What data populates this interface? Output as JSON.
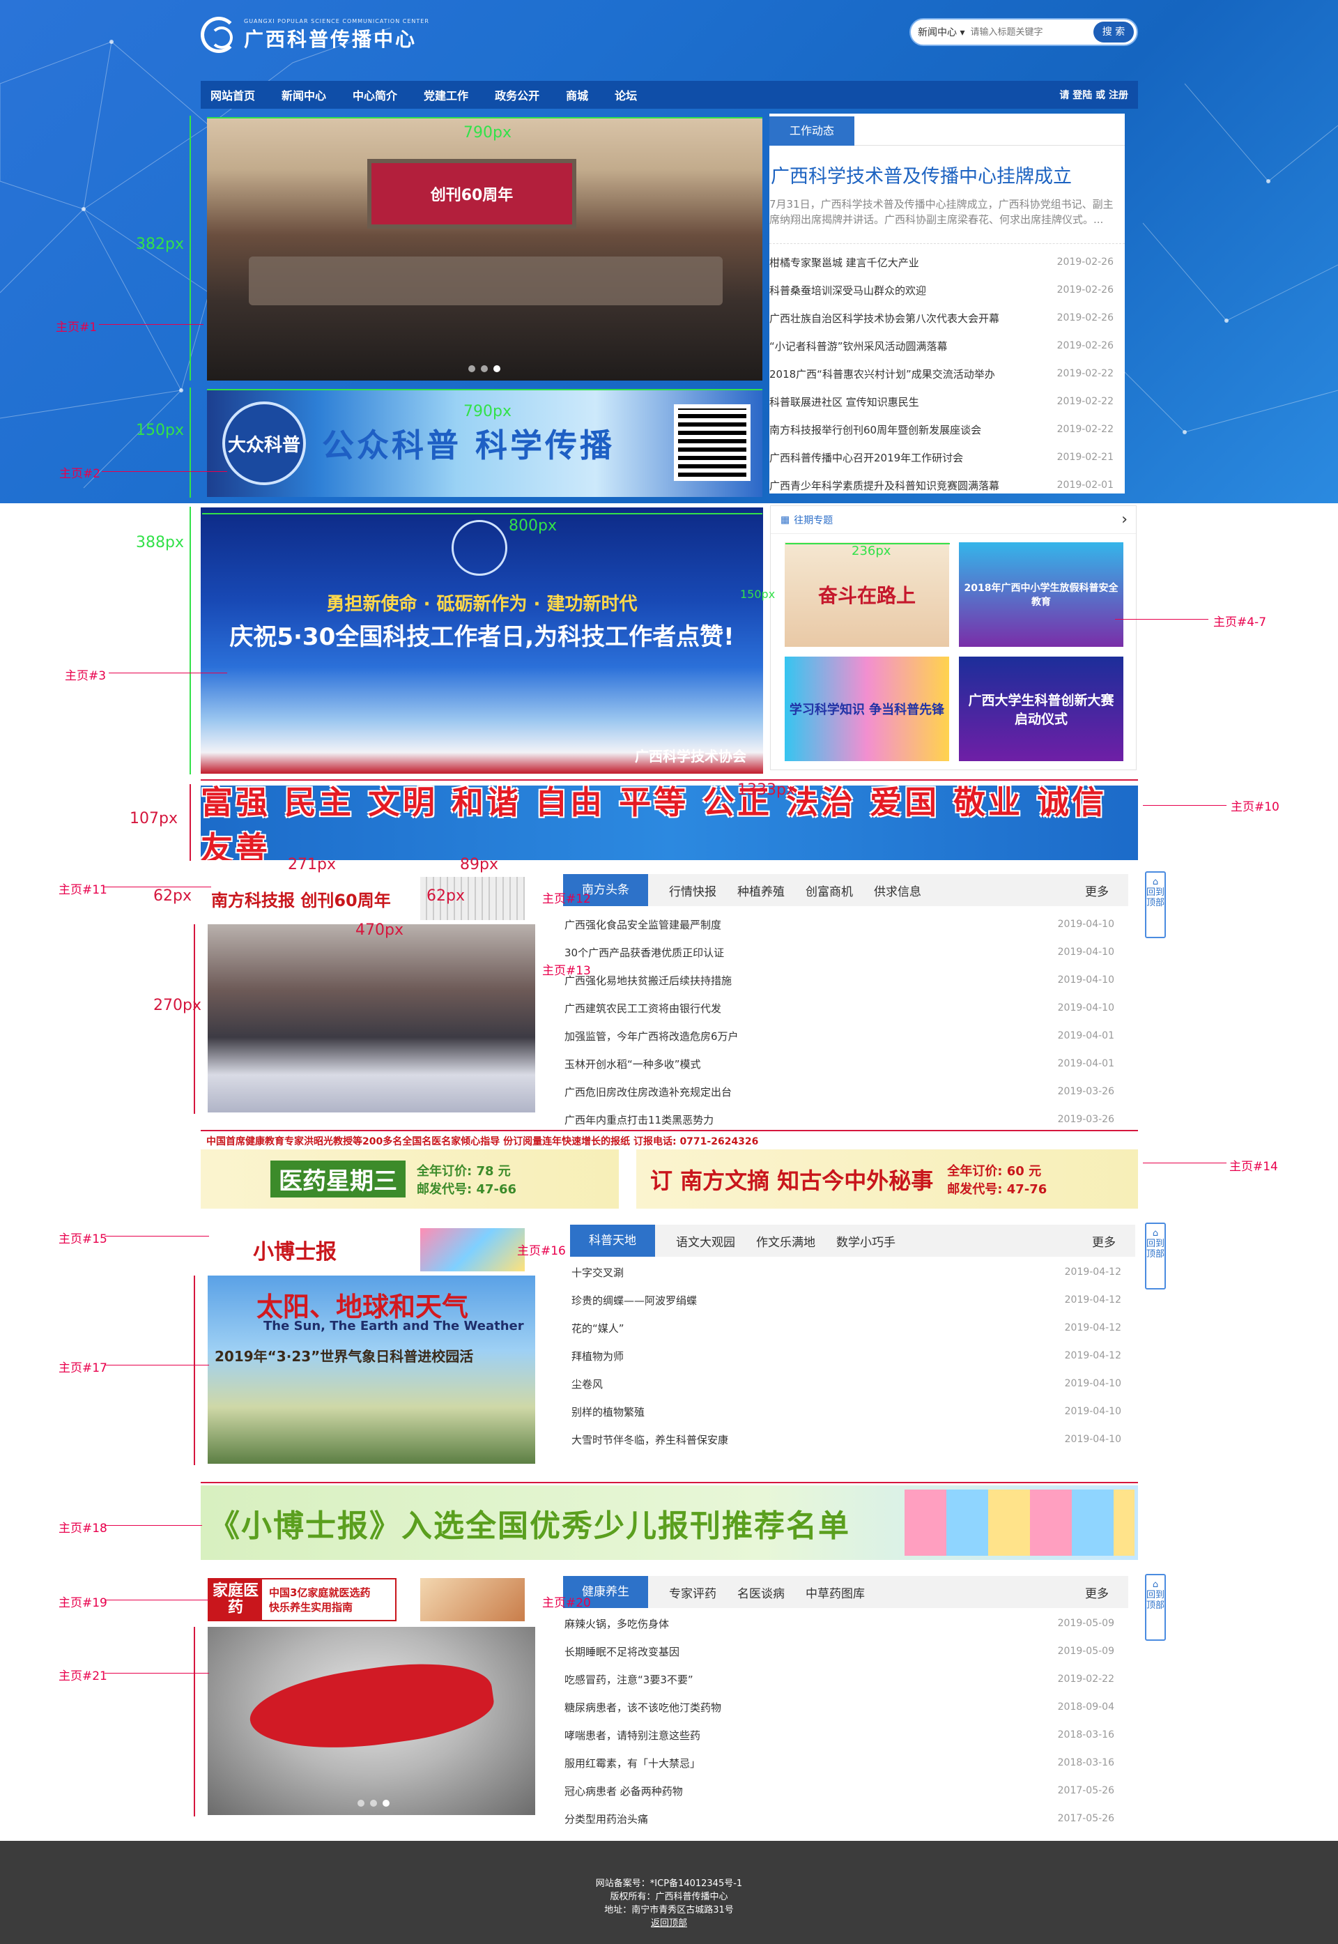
{
  "header": {
    "logo_en": "GUANGXI POPULAR SCIENCE COMMUNICATION CENTER",
    "logo_cn": "广西科普传播中心",
    "search_select": "新闻中心",
    "search_placeholder": "请输入标题关键字",
    "search_button": "搜 索"
  },
  "nav": {
    "items": [
      "网站首页",
      "新闻中心",
      "中心简介",
      "党建工作",
      "政务公开",
      "商城",
      "论坛"
    ],
    "login": "请 登陆 或 注册"
  },
  "work_news": {
    "tab": "工作动态",
    "lead_title": "广西科学技术普及传播中心挂牌成立",
    "lead_text": "7月31日，广西科学技术普及传播中心挂牌成立，广西科协党组书记、副主席纳翔出席揭牌并讲话。广西科协副主席梁春花、何求出席挂牌仪式。...",
    "items": [
      {
        "title": "柑橘专家聚邕城 建言千亿大产业",
        "date": "2019-02-26"
      },
      {
        "title": "科普桑蚕培训深受马山群众的欢迎",
        "date": "2019-02-26"
      },
      {
        "title": "广西壮族自治区科学技术协会第八次代表大会开幕",
        "date": "2019-02-26"
      },
      {
        "title": "“小记者科普游”钦州采风活动圆满落幕",
        "date": "2019-02-26"
      },
      {
        "title": "2018广西“科普惠农兴村计划”成果交流活动举办",
        "date": "2019-02-22"
      },
      {
        "title": "科普联展进社区 宣传知识惠民生",
        "date": "2019-02-22"
      },
      {
        "title": "南方科技报举行创刊60周年暨创新发展座谈会",
        "date": "2019-02-22"
      },
      {
        "title": "广西科普传播中心召开2019年工作研讨会",
        "date": "2019-02-21"
      },
      {
        "title": "广西青少年科学素质提升及科普知识竞赛圆满落幕",
        "date": "2019-02-01"
      }
    ]
  },
  "slides": {
    "banner2_text": "公众科普 科学传播",
    "banner2_logo": "大众科普",
    "banner3_line1": "勇担新使命 · 砥砺新作为 · 建功新时代",
    "banner3_line2": "庆祝5·30全国科技工作者日,为科技工作者点赞!",
    "banner3_org": "广西科学技术协会",
    "photo1_caption": "创刊60周年"
  },
  "topics": {
    "header": "往期专题",
    "tiles": [
      "奋斗在路上",
      "2018年广西中小学生放假科普安全教育",
      "学习科学知识 争当科普先锋",
      "广西大学生科普创新大赛启动仪式"
    ]
  },
  "banners": {
    "values": "富强 民主 文明 和谐 自由 平等 公正 法治 爱国 敬业 诚信 友善",
    "health_paper": "医药星期三",
    "health_price": "全年订价: 78 元",
    "health_code": "邮发代号: 47-66",
    "south_digest": "订 南方文摘 知古今中外秘事",
    "south_price": "全年订价: 60 元",
    "south_code": "邮发代号: 47-76",
    "top_strip": "中国首席健康教育专家洪昭光教授等200多名全国名医名家倾心指导   份订阅量连年快速增长的报纸   订报电话: 0771-2624326",
    "kid_banner": "《小博士报》入选全国优秀少儿报刊推荐名单"
  },
  "sections": [
    {
      "tabs": [
        "南方头条",
        "行情快报",
        "种植养殖",
        "创富商机",
        "供求信息"
      ],
      "more": "更多",
      "side_tag": "回到顶部",
      "logo_text": "南方科技报 创刊60周年",
      "items": [
        {
          "title": "广西强化食品安全监管建最严制度",
          "date": "2019-04-10"
        },
        {
          "title": "30个广西产品获香港优质正印认证",
          "date": "2019-04-10"
        },
        {
          "title": "广西强化易地扶贫搬迁后续扶持措施",
          "date": "2019-04-10"
        },
        {
          "title": "广西建筑农民工工资将由银行代发",
          "date": "2019-04-10"
        },
        {
          "title": "加强监管，今年广西将改造危房6万户",
          "date": "2019-04-01"
        },
        {
          "title": "玉林开创水稻“一种多收”模式",
          "date": "2019-04-01"
        },
        {
          "title": "广西危旧房改住房改造补充规定出台",
          "date": "2019-03-26"
        },
        {
          "title": "广西年内重点打击11类黑恶势力",
          "date": "2019-03-26"
        }
      ]
    },
    {
      "tabs": [
        "科普天地",
        "语文大观园",
        "作文乐满地",
        "数学小巧手"
      ],
      "more": "更多",
      "side_tag": "回到顶部",
      "logo_text": "小博士报",
      "photo_title": "太阳、地球和天气",
      "photo_sub": "The Sun, The Earth and The Weather",
      "photo_line": "2019年“3·23”世界气象日科普进校园活",
      "items": [
        {
          "title": "十字交叉涮",
          "date": "2019-04-12"
        },
        {
          "title": "珍贵的绸蝶——阿波罗绢蝶",
          "date": "2019-04-12"
        },
        {
          "title": "花的“媒人”",
          "date": "2019-04-12"
        },
        {
          "title": "拜植物为师",
          "date": "2019-04-12"
        },
        {
          "title": "尘卷风",
          "date": "2019-04-10"
        },
        {
          "title": "别样的植物繁殖",
          "date": "2019-04-10"
        },
        {
          "title": "大雪时节伴冬临，养生科普保安康",
          "date": "2019-04-10"
        }
      ]
    },
    {
      "tabs": [
        "健康养生",
        "专家评药",
        "名医谈病",
        "中草药图库"
      ],
      "more": "更多",
      "side_tag": "回到顶部",
      "logo_text": "家庭医药",
      "logo_sub1": "中国3亿家庭就医选药",
      "logo_sub2": "快乐养生实用指南",
      "items": [
        {
          "title": "麻辣火锅，多吃伤身体",
          "date": "2019-05-09"
        },
        {
          "title": "长期睡眠不足将改变基因",
          "date": "2019-05-09"
        },
        {
          "title": "吃感冒药，注意“3要3不要”",
          "date": "2019-02-22"
        },
        {
          "title": "糖尿病患者，该不该吃他汀类药物",
          "date": "2018-09-04"
        },
        {
          "title": "哮喘患者，请特别注意这些药",
          "date": "2018-03-16"
        },
        {
          "title": "服用红霉素，有「十大禁忌」",
          "date": "2018-03-16"
        },
        {
          "title": "冠心病患者 必备两种药物",
          "date": "2017-05-26"
        },
        {
          "title": "分类型用药治头痛",
          "date": "2017-05-26"
        }
      ]
    }
  ],
  "annotations": {
    "labels": [
      "主页#1",
      "主页#2",
      "主页#3",
      "主页#4-7",
      "主页#10",
      "主页#11",
      "主页#12",
      "主页#13",
      "主页#14",
      "主页#15",
      "主页#16",
      "主页#17",
      "主页#18",
      "主页#19",
      "主页#20",
      "主页#21"
    ],
    "dims": [
      "790px",
      "382px",
      "790px",
      "150px",
      "800px",
      "388px",
      "236px",
      "150px",
      "1333px",
      "107px",
      "271px",
      "89px",
      "62px",
      "62px",
      "470px",
      "270px"
    ]
  },
  "footer": {
    "line1": "网站备案号：*ICP备14012345号-1",
    "line2": "版权所有：广西科普传播中心",
    "line3": "地址：南宁市青秀区古城路31号",
    "back": "返回顶部"
  }
}
